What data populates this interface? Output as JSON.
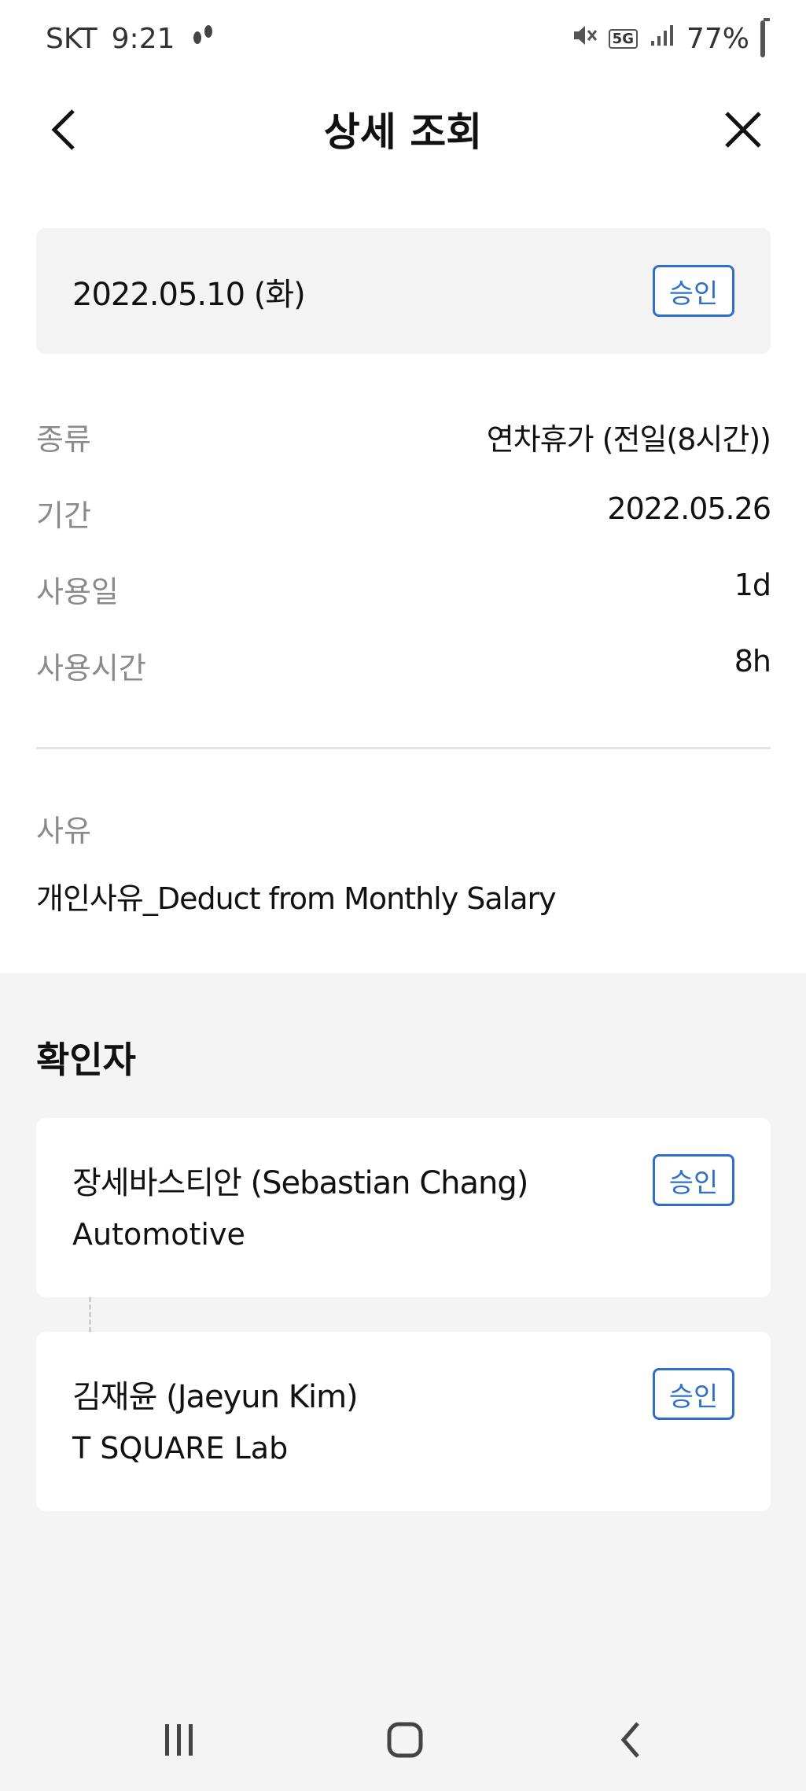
{
  "status_bar": {
    "carrier": "SKT",
    "time": "9:21",
    "network": "5G",
    "battery": "77%"
  },
  "header": {
    "title": "상세 조회"
  },
  "summary": {
    "date": "2022.05.10 (화)",
    "status": "승인"
  },
  "details": [
    {
      "label": "종류",
      "value": "연차휴가 (전일(8시간))"
    },
    {
      "label": "기간",
      "value": "2022.05.26"
    },
    {
      "label": "사용일",
      "value": "1d"
    },
    {
      "label": "사용시간",
      "value": "8h"
    }
  ],
  "reason": {
    "label": "사유",
    "text": "개인사유_Deduct from Monthly Salary"
  },
  "approvers": {
    "title": "확인자",
    "items": [
      {
        "name": "장세바스티안 (Sebastian Chang)",
        "department": "Automotive",
        "status": "승인"
      },
      {
        "name": "김재윤 (Jaeyun Kim)",
        "department": "T SQUARE Lab",
        "status": "승인"
      }
    ]
  },
  "icons": {
    "back": "chevron-left-icon",
    "close": "close-icon",
    "nav_recent": "recent-apps-icon",
    "nav_home": "home-icon",
    "nav_back": "nav-back-icon"
  },
  "colors": {
    "accent": "#2f6fc9",
    "label_gray": "#8a8a8a",
    "card_bg": "#f3f3f3",
    "section_bg": "#f4f4f4"
  }
}
